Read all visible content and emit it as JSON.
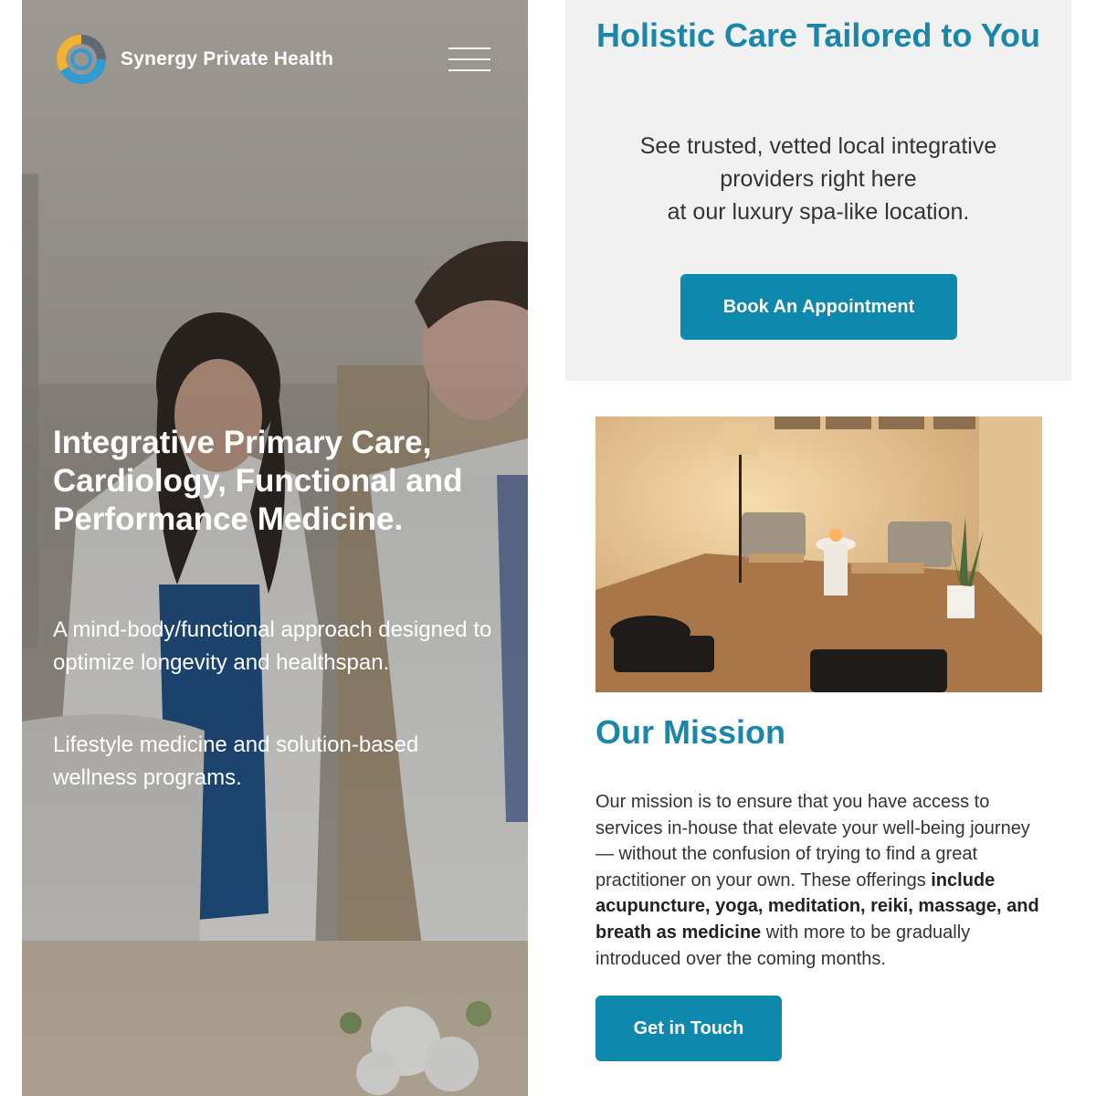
{
  "colors": {
    "accent": "#1a86aa",
    "button": "#0f88ad",
    "cta_background": "#f1f1f1",
    "logo_blue": "#2f9bd0",
    "logo_gold": "#f2b233",
    "logo_gray": "#5f6b73"
  },
  "left_screen": {
    "brand": {
      "name": "Synergy Private Health",
      "logo_icon": "synergy-swirl-logo"
    },
    "menu_icon": "hamburger-menu-icon",
    "hero": {
      "title": "Integrative Primary Care, Cardiology,  Functional and Performance Medicine.",
      "subtitle_1": "A mind-body/functional approach designed to optimize longevity and healthspan.",
      "subtitle_2": "Lifestyle medicine and solution-based wellness programs."
    }
  },
  "right_screen": {
    "cta": {
      "title": "Holistic Care Tailored to You",
      "text_line_1": "See trusted, vetted local integrative providers right here",
      "text_line_2": "at our luxury spa-like location.",
      "button_label": "Book An Appointment"
    },
    "mission": {
      "title": "Our Mission",
      "text_intro": "Our mission is to ensure that you have access to services in-house that elevate your well-being journey — without the confusion of trying to find a great practitioner on your own. These offerings ",
      "text_bold": "include acupuncture, yoga, meditation, reiki, massage, and breath as medicine",
      "text_outro": " with more to be gradually introduced over the coming months.",
      "button_label": "Get in Touch"
    }
  }
}
